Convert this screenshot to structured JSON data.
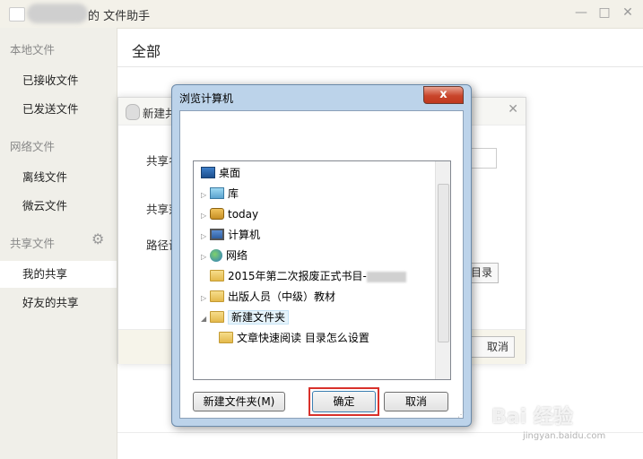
{
  "window": {
    "title": "的 文件助手",
    "buttons": {
      "minimize": "—",
      "maximize": "□",
      "close": "✕"
    }
  },
  "sidebar": {
    "sections": [
      {
        "label": "本地文件",
        "items": [
          "已接收文件",
          "已发送文件"
        ]
      },
      {
        "label": "网络文件",
        "items": [
          "离线文件",
          "微云文件"
        ]
      },
      {
        "label": "共享文件",
        "items": [
          "我的共享",
          "好友的共享"
        ]
      }
    ],
    "active_item": "我的共享",
    "settings_icon": "gear-icon"
  },
  "content": {
    "title": "全部"
  },
  "share_dialog": {
    "title": "新建共",
    "labels": [
      "共享名",
      "共享范",
      "路径设"
    ],
    "dir_button": "目录",
    "cancel_button": "取消"
  },
  "browse_dialog": {
    "title": "浏览计算机",
    "close_label": "x",
    "tree": [
      {
        "label": "桌面",
        "icon": "desktop-icon",
        "expandable": false,
        "level": 0
      },
      {
        "label": "库",
        "icon": "library-icon",
        "expandable": true,
        "level": 1
      },
      {
        "label": "today",
        "icon": "user-icon",
        "expandable": true,
        "level": 1
      },
      {
        "label": "计算机",
        "icon": "computer-icon",
        "expandable": true,
        "level": 1
      },
      {
        "label": "网络",
        "icon": "network-icon",
        "expandable": true,
        "level": 1
      },
      {
        "label": "2015年第二次报废正式书目-",
        "icon": "folder-icon",
        "expandable": false,
        "level": 1
      },
      {
        "label": "出版人员（中级）教材",
        "icon": "folder-icon",
        "expandable": true,
        "level": 1
      },
      {
        "label": "新建文件夹",
        "icon": "folder-icon",
        "expandable": true,
        "expanded": true,
        "selected": true,
        "level": 1
      },
      {
        "label": "文章快速阅读 目录怎么设置",
        "icon": "folder-icon",
        "expandable": false,
        "level": 2
      }
    ],
    "buttons": {
      "new_folder": "新建文件夹(M)",
      "ok": "确定",
      "cancel": "取消"
    }
  },
  "watermark": {
    "main": "Bai 经验",
    "sub": "jingyan.baidu.com"
  }
}
